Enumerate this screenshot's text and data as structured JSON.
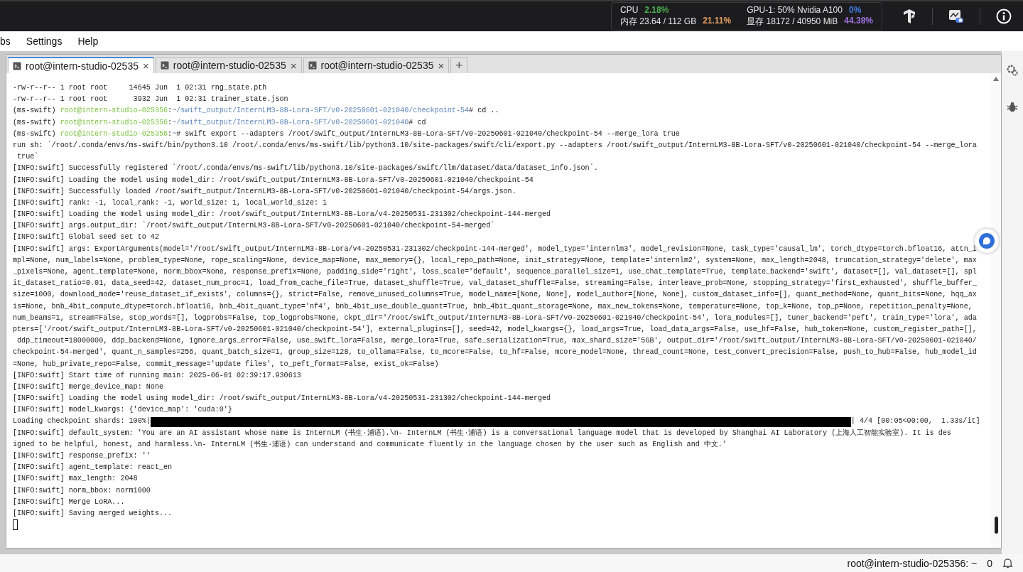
{
  "top_bar": {
    "stats": [
      {
        "label": "CPU",
        "value": "2.18%",
        "color": "#4caf50"
      },
      {
        "label": "GPU-1: 50% Nvidia A100",
        "value": "0%",
        "color": "#3f7fe0"
      },
      {
        "label": "内存 23.64 / 112 GB",
        "value": "21.11%",
        "color": "#e8a060"
      },
      {
        "label": "显存 18172 / 40950 MiB",
        "value": "44.38%",
        "color": "#a070e0"
      }
    ]
  },
  "menu": [
    "bs",
    "Settings",
    "Help"
  ],
  "tabs": [
    {
      "label": "root@intern-studio-02535",
      "close": "×",
      "selected": true
    },
    {
      "label": "root@intern-studio-02535",
      "close": "×",
      "selected": false
    },
    {
      "label": "root@intern-studio-02535",
      "close": "×",
      "selected": false
    }
  ],
  "new_tab": "+",
  "terminal": {
    "lines": [
      {
        "kind": "text",
        "text": "-rw-r--r-- 1 root root     14645 Jun  1 02:31 rng_state.pth"
      },
      {
        "kind": "text",
        "text": "-rw-r--r-- 1 root root      3932 Jun  1 02:31 trainer_state.json"
      },
      {
        "kind": "prompt",
        "env": "(ms-swift) ",
        "user": "root@intern-studio-025356",
        "sep": ":",
        "path": "~/swift_output/InternLM3-8B-Lora-SFT/v0-20250601-021040/checkpoint-54",
        "command": "# cd .."
      },
      {
        "kind": "prompt",
        "env": "(ms-swift) ",
        "user": "root@intern-studio-025356",
        "sep": ":",
        "path": "~/swift_output/InternLM3-8B-Lora-SFT/v0-20250601-021040",
        "command": "# cd"
      },
      {
        "kind": "prompt",
        "env": "(ms-swift) ",
        "user": "root@intern-studio-025356",
        "sep": ":",
        "path": "~",
        "command": "# swift export --adapters /root/swift_output/InternLM3-8B-Lora-SFT/v0-20250601-021040/checkpoint-54 --merge_lora true"
      },
      {
        "kind": "text",
        "text": "run sh: `/root/.conda/envs/ms-swift/bin/python3.10 /root/.conda/envs/ms-swift/lib/python3.10/site-packages/swift/cli/export.py --adapters /root/swift_output/InternLM3-8B-Lora-SFT/v0-20250601-021040/checkpoint-54 --merge_lora"
      },
      {
        "kind": "text",
        "text": " true`"
      },
      {
        "kind": "text",
        "text": "[INFO:swift] Successfully registered `/root/.conda/envs/ms-swift/lib/python3.10/site-packages/swift/llm/dataset/data/dataset_info.json`."
      },
      {
        "kind": "text",
        "text": "[INFO:swift] Loading the model using model_dir: /root/swift_output/InternLM3-8B-Lora-SFT/v0-20250601-021040/checkpoint-54"
      },
      {
        "kind": "text",
        "text": "[INFO:swift] Successfully loaded /root/swift_output/InternLM3-8B-Lora-SFT/v0-20250601-021040/checkpoint-54/args.json."
      },
      {
        "kind": "text",
        "text": "[INFO:swift] rank: -1, local_rank: -1, world_size: 1, local_world_size: 1"
      },
      {
        "kind": "text",
        "text": "[INFO:swift] Loading the model using model_dir: /root/swift_output/InternLM3-8B-Lora/v4-20250531-231302/checkpoint-144-merged"
      },
      {
        "kind": "text",
        "text": "[INFO:swift] args.output_dir: `/root/swift_output/InternLM3-8B-Lora-SFT/v0-20250601-021040/checkpoint-54-merged`"
      },
      {
        "kind": "text",
        "text": "[INFO:swift] Global seed set to 42"
      },
      {
        "kind": "text",
        "text": "[INFO:swift] args: ExportArguments(model='/root/swift_output/InternLM3-8B-Lora/v4-20250531-231302/checkpoint-144-merged', model_type='internlm3', model_revision=None, task_type='causal_lm', torch_dtype=torch.bfloat16, attn_i"
      },
      {
        "kind": "text",
        "text": "mpl=None, num_labels=None, problem_type=None, rope_scaling=None, device_map=None, max_memory={}, local_repo_path=None, init_strategy=None, template='internlm2', system=None, max_length=2048, truncation_strategy='delete', max"
      },
      {
        "kind": "text",
        "text": "_pixels=None, agent_template=None, norm_bbox=None, response_prefix=None, padding_side='right', loss_scale='default', sequence_parallel_size=1, use_chat_template=True, template_backend='swift', dataset=[], val_dataset=[], spl"
      },
      {
        "kind": "text",
        "text": "it_dataset_ratio=0.01, data_seed=42, dataset_num_proc=1, load_from_cache_file=True, dataset_shuffle=True, val_dataset_shuffle=False, streaming=False, interleave_prob=None, stopping_strategy='first_exhausted', shuffle_buffer_"
      },
      {
        "kind": "text",
        "text": "size=1000, download_mode='reuse_dataset_if_exists', columns={}, strict=False, remove_unused_columns=True, model_name=[None, None], model_author=[None, None], custom_dataset_info=[], quant_method=None, quant_bits=None, hqq_ax"
      },
      {
        "kind": "text",
        "text": "is=None, bnb_4bit_compute_dtype=torch.bfloat16, bnb_4bit_quant_type='nf4', bnb_4bit_use_double_quant=True, bnb_4bit_quant_storage=None, max_new_tokens=None, temperature=None, top_k=None, top_p=None, repetition_penalty=None,"
      },
      {
        "kind": "text",
        "text": "num_beams=1, stream=False, stop_words=[], logprobs=False, top_logprobs=None, ckpt_dir='/root/swift_output/InternLM3-8B-Lora-SFT/v0-20250601-021040/checkpoint-54', lora_modules=[], tuner_backend='peft', train_type='lora', ada"
      },
      {
        "kind": "text",
        "text": "pters=['/root/swift_output/InternLM3-8B-Lora-SFT/v0-20250601-021040/checkpoint-54'], external_plugins=[], seed=42, model_kwargs={}, load_args=True, load_data_args=False, use_hf=False, hub_token=None, custom_register_path=[],"
      },
      {
        "kind": "text",
        "text": " ddp_timeout=18000000, ddp_backend=None, ignore_args_error=False, use_swift_lora=False, merge_lora=True, safe_serialization=True, max_shard_size='5GB', output_dir='/root/swift_output/InternLM3-8B-Lora-SFT/v0-20250601-021040/"
      },
      {
        "kind": "text",
        "text": "checkpoint-54-merged', quant_n_samples=256, quant_batch_size=1, group_size=128, to_ollama=False, to_mcore=False, to_hf=False, mcore_model=None, thread_count=None, test_convert_precision=False, push_to_hub=False, hub_model_id"
      },
      {
        "kind": "text",
        "text": "=None, hub_private_repo=False, commit_message='update files', to_peft_format=False, exist_ok=False)"
      },
      {
        "kind": "text",
        "text": "[INFO:swift] Start time of running main: 2025-06-01 02:39:17.930613"
      },
      {
        "kind": "text",
        "text": "[INFO:swift] merge_device_map: None"
      },
      {
        "kind": "text",
        "text": "[INFO:swift] Loading the model using model_dir: /root/swift_output/InternLM3-8B-Lora/v4-20250531-231302/checkpoint-144-merged"
      },
      {
        "kind": "text",
        "text": "[INFO:swift] model_kwargs: {'device_map': 'cuda:0'}"
      },
      {
        "kind": "progress",
        "label": "Loading checkpoint shards: 100%|",
        "level": 1,
        "tail": "| 4/4 [00:05<00:00,  1.33s/it]"
      },
      {
        "kind": "text",
        "text": "[INFO:swift] default_system: 'You are an AI assistant whose name is InternLM (书生·浦语).\\n- InternLM (书生·浦语) is a conversational language model that is developed by Shanghai AI Laboratory (上海人工智能实验室). It is des"
      },
      {
        "kind": "text",
        "text": "igned to be helpful, honest, and harmless.\\n- InternLM (书生·浦语) can understand and communicate fluently in the language chosen by the user such as English and 中文.'"
      },
      {
        "kind": "text",
        "text": "[INFO:swift] response_prefix: ''"
      },
      {
        "kind": "text",
        "text": "[INFO:swift] agent_template: react_en"
      },
      {
        "kind": "text",
        "text": "[INFO:swift] max_length: 2048"
      },
      {
        "kind": "text",
        "text": "[INFO:swift] norm_bbox: norm1000"
      },
      {
        "kind": "text",
        "text": "[INFO:swift] Merge LoRA..."
      },
      {
        "kind": "text",
        "text": "[INFO:swift] Saving merged weights..."
      },
      {
        "kind": "cursor"
      }
    ]
  },
  "status_bar": {
    "host": "root@intern-studio-025356: ~",
    "count": "0"
  }
}
